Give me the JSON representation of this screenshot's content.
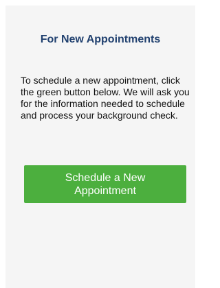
{
  "new_appointments": {
    "heading": "For New Appointments",
    "description": "To schedule a new appointment, click the green button below. We will ask you for the information needed to schedule and process your background check.",
    "button_label": "Schedule a New Appointment"
  },
  "colors": {
    "heading": "#1f3f6e",
    "button_background": "#4caf3e",
    "button_text": "#ffffff",
    "panel_background": "#f5f5f5"
  }
}
